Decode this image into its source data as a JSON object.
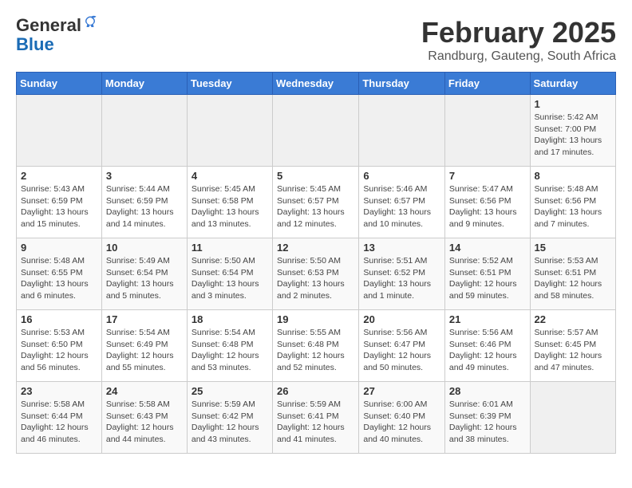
{
  "header": {
    "logo_general": "General",
    "logo_blue": "Blue",
    "month_year": "February 2025",
    "location": "Randburg, Gauteng, South Africa"
  },
  "calendar": {
    "days_of_week": [
      "Sunday",
      "Monday",
      "Tuesday",
      "Wednesday",
      "Thursday",
      "Friday",
      "Saturday"
    ],
    "weeks": [
      [
        {
          "day": "",
          "detail": ""
        },
        {
          "day": "",
          "detail": ""
        },
        {
          "day": "",
          "detail": ""
        },
        {
          "day": "",
          "detail": ""
        },
        {
          "day": "",
          "detail": ""
        },
        {
          "day": "",
          "detail": ""
        },
        {
          "day": "1",
          "detail": "Sunrise: 5:42 AM\nSunset: 7:00 PM\nDaylight: 13 hours and 17 minutes."
        }
      ],
      [
        {
          "day": "2",
          "detail": "Sunrise: 5:43 AM\nSunset: 6:59 PM\nDaylight: 13 hours and 15 minutes."
        },
        {
          "day": "3",
          "detail": "Sunrise: 5:44 AM\nSunset: 6:59 PM\nDaylight: 13 hours and 14 minutes."
        },
        {
          "day": "4",
          "detail": "Sunrise: 5:45 AM\nSunset: 6:58 PM\nDaylight: 13 hours and 13 minutes."
        },
        {
          "day": "5",
          "detail": "Sunrise: 5:45 AM\nSunset: 6:57 PM\nDaylight: 13 hours and 12 minutes."
        },
        {
          "day": "6",
          "detail": "Sunrise: 5:46 AM\nSunset: 6:57 PM\nDaylight: 13 hours and 10 minutes."
        },
        {
          "day": "7",
          "detail": "Sunrise: 5:47 AM\nSunset: 6:56 PM\nDaylight: 13 hours and 9 minutes."
        },
        {
          "day": "8",
          "detail": "Sunrise: 5:48 AM\nSunset: 6:56 PM\nDaylight: 13 hours and 7 minutes."
        }
      ],
      [
        {
          "day": "9",
          "detail": "Sunrise: 5:48 AM\nSunset: 6:55 PM\nDaylight: 13 hours and 6 minutes."
        },
        {
          "day": "10",
          "detail": "Sunrise: 5:49 AM\nSunset: 6:54 PM\nDaylight: 13 hours and 5 minutes."
        },
        {
          "day": "11",
          "detail": "Sunrise: 5:50 AM\nSunset: 6:54 PM\nDaylight: 13 hours and 3 minutes."
        },
        {
          "day": "12",
          "detail": "Sunrise: 5:50 AM\nSunset: 6:53 PM\nDaylight: 13 hours and 2 minutes."
        },
        {
          "day": "13",
          "detail": "Sunrise: 5:51 AM\nSunset: 6:52 PM\nDaylight: 13 hours and 1 minute."
        },
        {
          "day": "14",
          "detail": "Sunrise: 5:52 AM\nSunset: 6:51 PM\nDaylight: 12 hours and 59 minutes."
        },
        {
          "day": "15",
          "detail": "Sunrise: 5:53 AM\nSunset: 6:51 PM\nDaylight: 12 hours and 58 minutes."
        }
      ],
      [
        {
          "day": "16",
          "detail": "Sunrise: 5:53 AM\nSunset: 6:50 PM\nDaylight: 12 hours and 56 minutes."
        },
        {
          "day": "17",
          "detail": "Sunrise: 5:54 AM\nSunset: 6:49 PM\nDaylight: 12 hours and 55 minutes."
        },
        {
          "day": "18",
          "detail": "Sunrise: 5:54 AM\nSunset: 6:48 PM\nDaylight: 12 hours and 53 minutes."
        },
        {
          "day": "19",
          "detail": "Sunrise: 5:55 AM\nSunset: 6:48 PM\nDaylight: 12 hours and 52 minutes."
        },
        {
          "day": "20",
          "detail": "Sunrise: 5:56 AM\nSunset: 6:47 PM\nDaylight: 12 hours and 50 minutes."
        },
        {
          "day": "21",
          "detail": "Sunrise: 5:56 AM\nSunset: 6:46 PM\nDaylight: 12 hours and 49 minutes."
        },
        {
          "day": "22",
          "detail": "Sunrise: 5:57 AM\nSunset: 6:45 PM\nDaylight: 12 hours and 47 minutes."
        }
      ],
      [
        {
          "day": "23",
          "detail": "Sunrise: 5:58 AM\nSunset: 6:44 PM\nDaylight: 12 hours and 46 minutes."
        },
        {
          "day": "24",
          "detail": "Sunrise: 5:58 AM\nSunset: 6:43 PM\nDaylight: 12 hours and 44 minutes."
        },
        {
          "day": "25",
          "detail": "Sunrise: 5:59 AM\nSunset: 6:42 PM\nDaylight: 12 hours and 43 minutes."
        },
        {
          "day": "26",
          "detail": "Sunrise: 5:59 AM\nSunset: 6:41 PM\nDaylight: 12 hours and 41 minutes."
        },
        {
          "day": "27",
          "detail": "Sunrise: 6:00 AM\nSunset: 6:40 PM\nDaylight: 12 hours and 40 minutes."
        },
        {
          "day": "28",
          "detail": "Sunrise: 6:01 AM\nSunset: 6:39 PM\nDaylight: 12 hours and 38 minutes."
        },
        {
          "day": "",
          "detail": ""
        }
      ]
    ]
  }
}
